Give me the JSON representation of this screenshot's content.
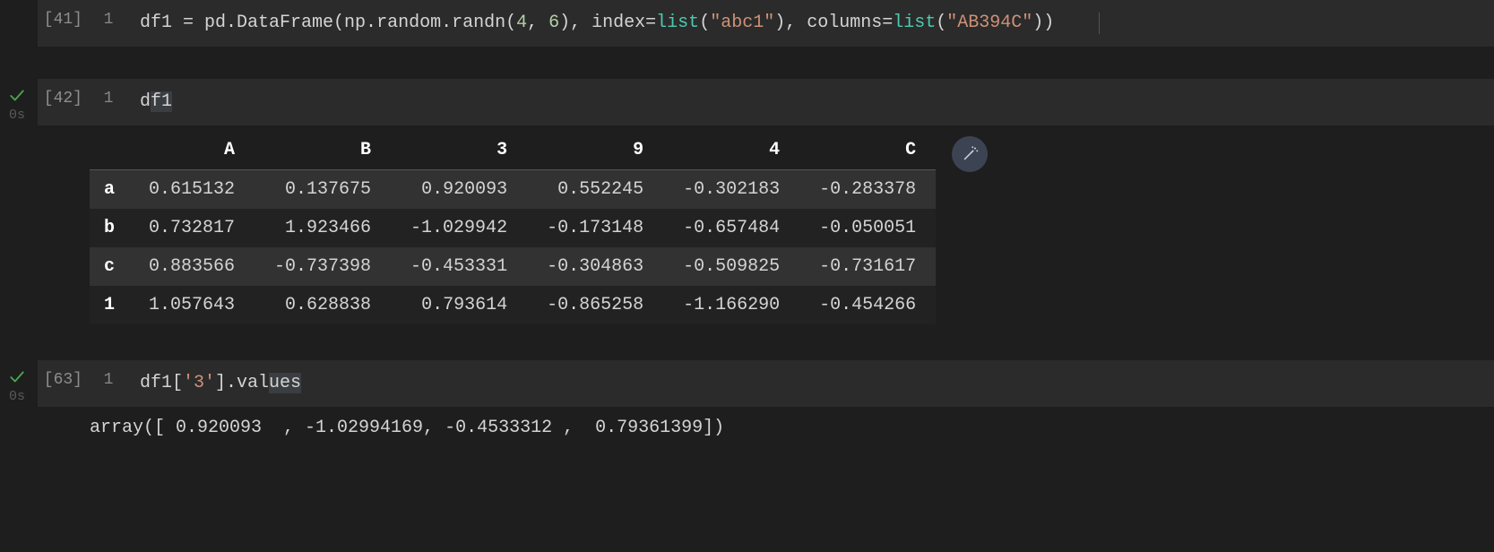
{
  "cells": [
    {
      "number": "[41]",
      "line": "1",
      "status": null,
      "status_time": null,
      "divider": true,
      "tokens": [
        {
          "t": "df1",
          "c": "tok-var"
        },
        {
          "t": " = ",
          "c": "tok-op"
        },
        {
          "t": "pd.DataFrame(np.random.randn(",
          "c": "tok-func"
        },
        {
          "t": "4",
          "c": "tok-num"
        },
        {
          "t": ", ",
          "c": "tok-op"
        },
        {
          "t": "6",
          "c": "tok-num"
        },
        {
          "t": "), index=",
          "c": "tok-op"
        },
        {
          "t": "list",
          "c": "tok-kw"
        },
        {
          "t": "(",
          "c": "tok-op"
        },
        {
          "t": "\"abc1\"",
          "c": "tok-str"
        },
        {
          "t": "), columns=",
          "c": "tok-op"
        },
        {
          "t": "list",
          "c": "tok-kw"
        },
        {
          "t": "(",
          "c": "tok-op"
        },
        {
          "t": "\"AB394C\"",
          "c": "tok-str"
        },
        {
          "t": "))",
          "c": "tok-op"
        }
      ],
      "output": null
    },
    {
      "number": "[42]",
      "line": "1",
      "status": "check",
      "status_time": "0s",
      "divider": false,
      "tokens": [
        {
          "t": "d",
          "c": "tok-var"
        },
        {
          "t": "f1",
          "c": "tok-var tok-sel"
        }
      ],
      "output": "dataframe"
    },
    {
      "number": "[63]",
      "line": "1",
      "status": "check",
      "status_time": "0s",
      "divider": false,
      "tokens": [
        {
          "t": "df1[",
          "c": "tok-var"
        },
        {
          "t": "'3'",
          "c": "tok-str"
        },
        {
          "t": "].val",
          "c": "tok-var"
        },
        {
          "t": "ues",
          "c": "tok-var tok-sel"
        }
      ],
      "output": "array"
    }
  ],
  "dataframe": {
    "columns": [
      "A",
      "B",
      "3",
      "9",
      "4",
      "C"
    ],
    "index": [
      "a",
      "b",
      "c",
      "1"
    ],
    "rows": [
      [
        "0.615132",
        "0.137675",
        "0.920093",
        "0.552245",
        "-0.302183",
        "-0.283378"
      ],
      [
        "0.732817",
        "1.923466",
        "-1.029942",
        "-0.173148",
        "-0.657484",
        "-0.050051"
      ],
      [
        "0.883566",
        "-0.737398",
        "-0.453331",
        "-0.304863",
        "-0.509825",
        "-0.731617"
      ],
      [
        "1.057643",
        "0.628838",
        "0.793614",
        "-0.865258",
        "-1.166290",
        "-0.454266"
      ]
    ]
  },
  "array_output": "array([ 0.920093  , -1.02994169, -0.4533312 ,  0.79361399])",
  "icons": {
    "magic": "magic-wand-icon",
    "check": "check-icon"
  },
  "colors": {
    "bg": "#1e1e1e",
    "cell_bg": "#2b2b2b",
    "row_odd": "#323232",
    "row_even": "#222222",
    "accent_green": "#4ca650",
    "num_green": "#b5cea8",
    "str_orange": "#ce9178",
    "kw_teal": "#4ec9b0"
  }
}
